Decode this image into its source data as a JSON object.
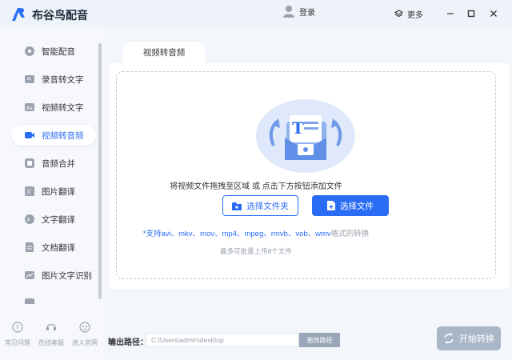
{
  "app": {
    "title": "布谷鸟配音"
  },
  "titlebar": {
    "login_label": "登录",
    "more_label": "更多"
  },
  "sidebar": {
    "items": [
      {
        "label": "智能配音",
        "icon": "smart-dubbing-icon",
        "active": false
      },
      {
        "label": "录音转文字",
        "icon": "audio-to-text-icon",
        "active": false
      },
      {
        "label": "视频转文字",
        "icon": "video-to-text-icon",
        "active": false
      },
      {
        "label": "视频转音频",
        "icon": "video-to-audio-icon",
        "active": true
      },
      {
        "label": "音频合并",
        "icon": "audio-merge-icon",
        "active": false
      },
      {
        "label": "图片翻译",
        "icon": "image-translate-icon",
        "active": false
      },
      {
        "label": "文字翻译",
        "icon": "text-translate-icon",
        "active": false
      },
      {
        "label": "文档翻译",
        "icon": "document-translate-icon",
        "active": false
      },
      {
        "label": "图片文字识别",
        "icon": "image-ocr-icon",
        "active": false
      }
    ],
    "bottom_links": [
      {
        "label": "常见问题",
        "icon": "help-icon"
      },
      {
        "label": "在线客服",
        "icon": "customer-service-icon"
      },
      {
        "label": "进入官网",
        "icon": "website-icon"
      }
    ]
  },
  "main": {
    "tab_label": "视频转音频",
    "drop_hint": "将视频文件拖拽至区域 或 点击下方按钮添加文件",
    "select_folder_label": "选择文件夹",
    "select_file_label": "选择文件",
    "formats_prefix": "*支持",
    "formats_list": "avi、mkv、mov、mp4、mpeg、rmvb、vob、wmv",
    "formats_suffix": "格式的转换",
    "limit_hint": "最多可批量上传8个文件"
  },
  "output": {
    "label": "输出路径：",
    "path": "C:\\Users\\admin\\desktop",
    "change_label": "更改路径",
    "start_label": "开始转换"
  },
  "colors": {
    "accent": "#2a6df4",
    "disabled": "#a9b6c8"
  }
}
